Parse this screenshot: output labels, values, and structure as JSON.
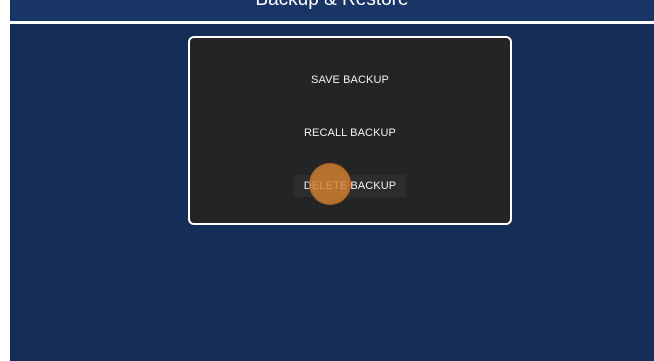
{
  "title_bar": {
    "title": "Backup & Restore"
  },
  "dialog": {
    "buttons": {
      "save": "SAVE BACKUP",
      "recall": "RECALL BACKUP",
      "delete": "DELETE BACKUP"
    }
  },
  "colors": {
    "background": "#142e58",
    "dialog_background": "#242424",
    "touch_indicator": "#d68032"
  }
}
